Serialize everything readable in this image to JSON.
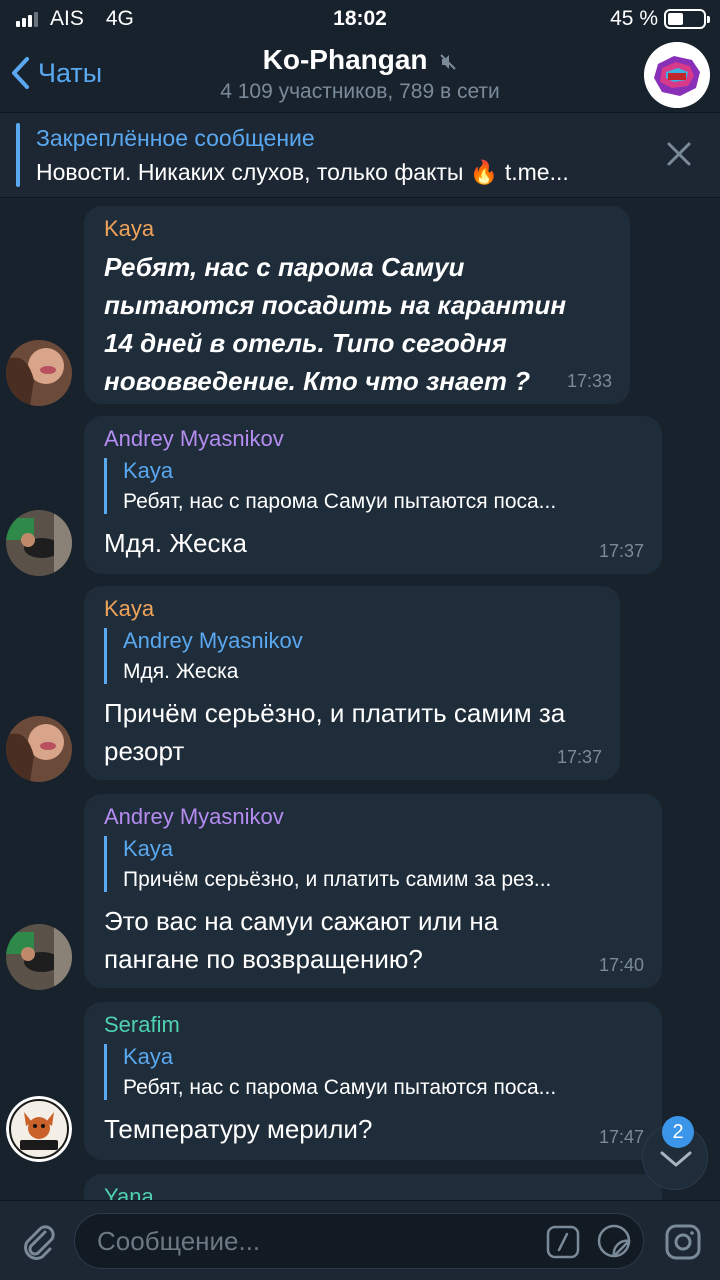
{
  "status_bar": {
    "carrier": "AIS",
    "network": "4G",
    "time": "18:02",
    "battery": "45 %",
    "battery_level": 0.45
  },
  "header": {
    "back_label": "Чаты",
    "title": "Ko-Phangan",
    "subtitle": "4 109 участников, 789 в сети"
  },
  "pinned": {
    "title": "Закреплённое сообщение",
    "text": "Новости. Никаких слухов, только факты 🔥 t.me..."
  },
  "messages": [
    {
      "sender": "Kaya",
      "sender_color": "#f0a35a",
      "text": "Ребят, нас с парома Самуи пытаются посадить на карантин 14 дней в отель. Типо сегодня нововведение. Кто что знает ?",
      "time": "17:33"
    },
    {
      "sender": "Andrey Myasnikov",
      "sender_color": "#b58cf0",
      "reply_name": "Kaya",
      "reply_text": "Ребят, нас с парома Самуи пытаются поса...",
      "text": "Мдя. Жеска",
      "time": "17:37"
    },
    {
      "sender": "Kaya",
      "sender_color": "#f0a35a",
      "reply_name": "Andrey Myasnikov",
      "reply_text": "Мдя. Жеска",
      "text": "Причём серьёзно, и платить самим за резорт",
      "time": "17:37"
    },
    {
      "sender": "Andrey Myasnikov",
      "sender_color": "#b58cf0",
      "reply_name": "Kaya",
      "reply_text": "Причём серьёзно, и платить самим за рез...",
      "text": "Это вас на самуи сажают или на пангане по возвращению?",
      "time": "17:40"
    },
    {
      "sender": "Serafim",
      "sender_color": "#4fd1b0",
      "reply_name": "Kaya",
      "reply_text": "Ребят, нас с парома Самуи пытаются поса...",
      "text": "Температуру мерили?",
      "time": "17:47"
    },
    {
      "sender": "Yana",
      "sender_color": "#4fd1b0"
    }
  ],
  "unread_count": "2",
  "input": {
    "placeholder": "Сообщение..."
  },
  "icons": {
    "back": "chevron-left-icon",
    "mute": "mute-icon",
    "close": "close-icon",
    "attach": "paperclip-icon",
    "commands": "slash-commands-icon",
    "sticker": "sticker-icon",
    "camera": "camera-icon",
    "scroll_down": "chevron-down-icon"
  }
}
